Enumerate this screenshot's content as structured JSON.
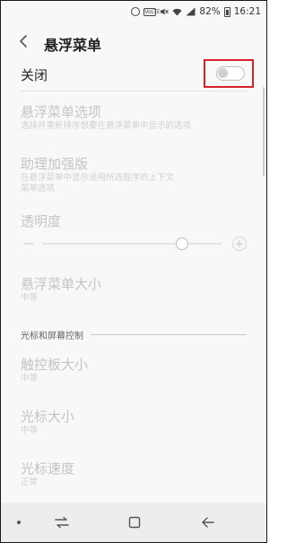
{
  "status_bar": {
    "battery": "82%",
    "time": "16:21",
    "data_badge": "VoLTE",
    "icons": [
      "alarm-icon",
      "data-badge-icon",
      "mute-icon",
      "wifi-icon",
      "signal-icon",
      "battery-icon"
    ]
  },
  "header": {
    "title": "悬浮菜单",
    "back_icon": "back-arrow-icon"
  },
  "master": {
    "label": "关闭",
    "toggle_on": false
  },
  "items": [
    {
      "title": "悬浮菜单选项",
      "subtitle": "选择并重新排序想要在悬浮菜单中显示的选项"
    },
    {
      "title": "助理加强版",
      "subtitle": "在悬浮菜单中显示适用所选程序的上下文菜单选项"
    },
    {
      "title": "透明度"
    },
    {
      "title": "悬浮菜单大小",
      "subtitle": "中等"
    }
  ],
  "transparency": {
    "level_fraction": 0.78,
    "minus_label": "−",
    "plus_label": "+"
  },
  "section": {
    "title": "光标和屏幕控制"
  },
  "cursor_items": [
    {
      "title": "触控板大小",
      "subtitle": "中等"
    },
    {
      "title": "光标大小",
      "subtitle": "中等"
    },
    {
      "title": "光标速度",
      "subtitle": "正常"
    }
  ],
  "navbar": {
    "icons": [
      "recents-icon",
      "home-icon",
      "back-icon"
    ]
  },
  "colors": {
    "highlight": "#d6232b",
    "disabled_text": "#c4c4c4"
  }
}
